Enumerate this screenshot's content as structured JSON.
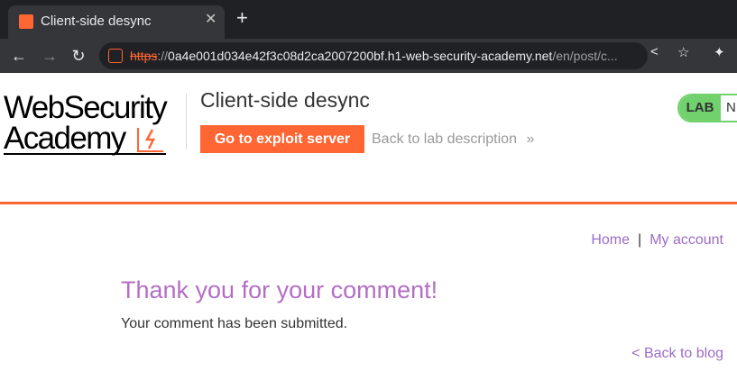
{
  "browser": {
    "tab_title": "Client-side desync",
    "tab_close": "✕",
    "new_tab": "+",
    "url_scheme": "https",
    "url_sep": "://",
    "url_host": "0a4e001d034e42f3c08d2ca2007200bf.h1-web-security-academy.net",
    "url_path": "/en/post/c...",
    "back": "←",
    "forward": "→",
    "reload": "↻",
    "share": "<",
    "bookmark": "☆",
    "extensions": "✦"
  },
  "header": {
    "logo_line1": "WebSecurity",
    "logo_line2": "Academy",
    "lab_title": "Client-side desync",
    "exploit_button": "Go to exploit server",
    "back_to_lab": "Back to lab description",
    "back_to_lab_chevron": "»",
    "lab_badge": "LAB",
    "lab_status_partial": "N"
  },
  "nav": {
    "home": "Home",
    "separator": "|",
    "my_account": "My account"
  },
  "main": {
    "heading": "Thank you for your comment!",
    "message": "Your comment has been submitted.",
    "back_link": "< Back to blog"
  },
  "colors": {
    "accent": "#ff6633",
    "link": "#9b6cc7",
    "heading": "#b46ec5",
    "lab_badge": "#70d16d"
  }
}
